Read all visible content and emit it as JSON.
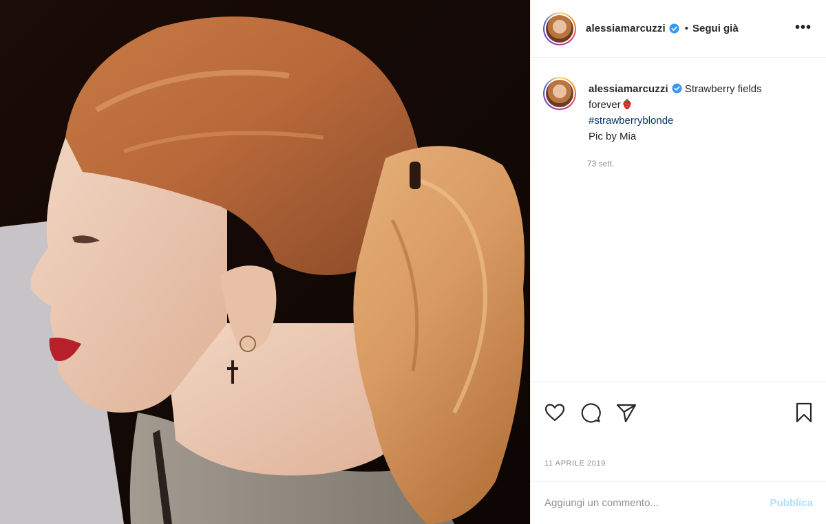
{
  "post": {
    "image_alt": "Woman in profile with strawberry blonde ponytail and small cross earring",
    "author": {
      "username": "alessiamarcuzzi",
      "verified": true,
      "avatar_icon": "avatar-photo"
    },
    "header": {
      "separator": "•",
      "follow_status": "Segui già",
      "more_label": "•••"
    },
    "caption": {
      "text_line1": "Strawberry fields",
      "text_line2": "forever",
      "emoji_icon": "strawberry-icon",
      "hashtag": "#strawberryblonde",
      "credit": "Pic by Mia",
      "time_ago": "73 sett."
    },
    "actions": {
      "like_icon": "heart-icon",
      "comment_icon": "comment-icon",
      "share_icon": "send-icon",
      "save_icon": "bookmark-icon"
    },
    "date": "11 APRILE 2019",
    "comment": {
      "placeholder": "Aggiungi un commento...",
      "publish_label": "Pubblica"
    }
  },
  "colors": {
    "link": "#00376b",
    "verified": "#3897f0",
    "muted": "#8e8e8e",
    "publish_disabled": "#b2dffc"
  }
}
